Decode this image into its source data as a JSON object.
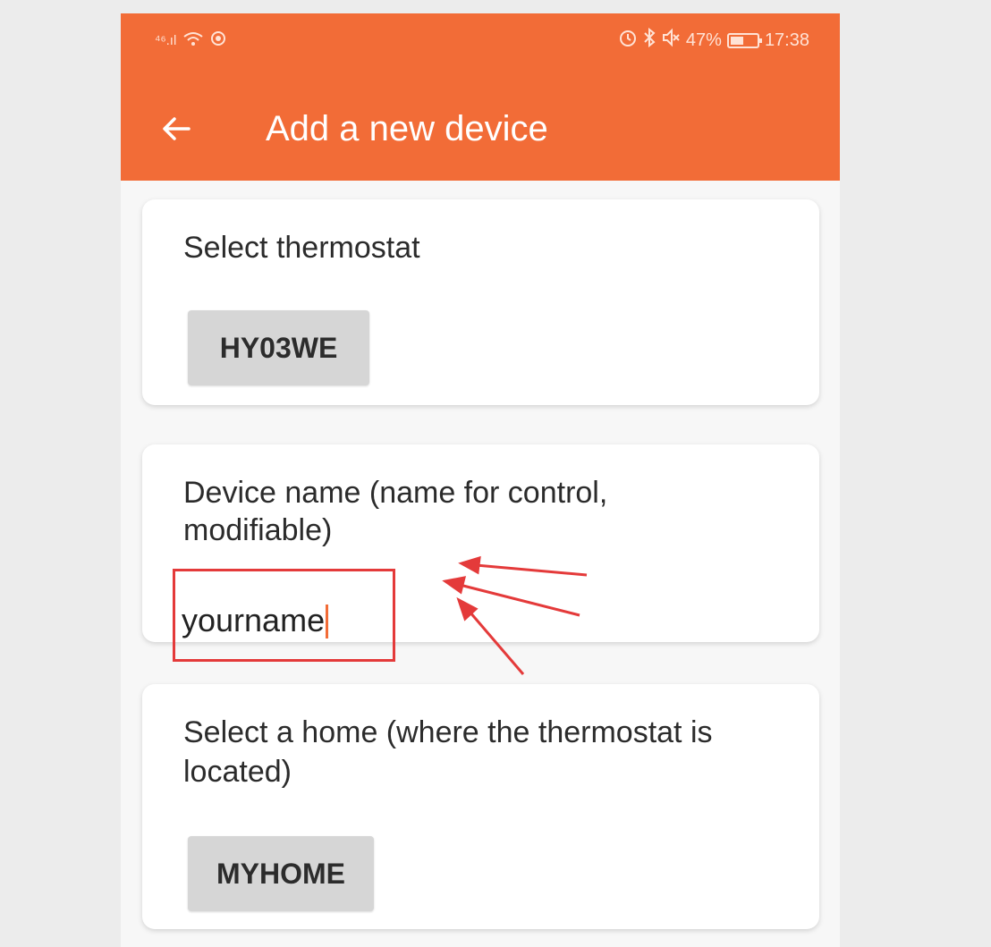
{
  "status_bar": {
    "network_label": "⁴⁶.ıl",
    "wifi_icon": "wifi-icon",
    "battery_percent": "47%",
    "time": "17:38"
  },
  "app_bar": {
    "title": "Add a new device",
    "background_color": "#f26c37"
  },
  "thermostat_card": {
    "label": "Select thermostat",
    "selected": "HY03WE"
  },
  "device_name_card": {
    "label_line1": "Device name (name for control,",
    "label_line2": "modifiable)",
    "value": "yourname"
  },
  "home_card": {
    "label_line1": "Select a home (where the thermostat is",
    "label_line2": "located)",
    "selected": "MYHOME"
  },
  "annotation": {
    "color": "#e43a3a"
  }
}
